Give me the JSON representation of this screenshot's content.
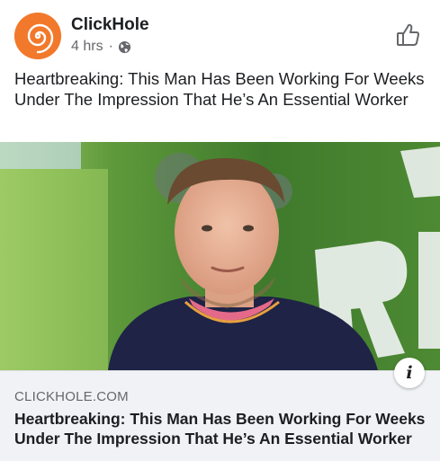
{
  "post": {
    "page_name": "ClickHole",
    "time": "4 hrs",
    "separator": "·",
    "caption": "Heartbreaking: This Man Has Been Working For Weeks Under The Impression That He’s An Essential Worker"
  },
  "link": {
    "domain": "CLICKHOLE.COM",
    "title": "Heartbreaking: This Man Has Been Working For Weeks Under The Impression That He’s An Essential Worker",
    "info_label": "i"
  },
  "icons": {
    "avatar": "clickhole-logo",
    "privacy": "globe-icon",
    "like": "thumbs-up-icon",
    "info": "info-icon"
  },
  "colors": {
    "brand_orange": "#f2792b",
    "meta_gray": "#65676b",
    "card_bg": "#f0f2f5"
  }
}
